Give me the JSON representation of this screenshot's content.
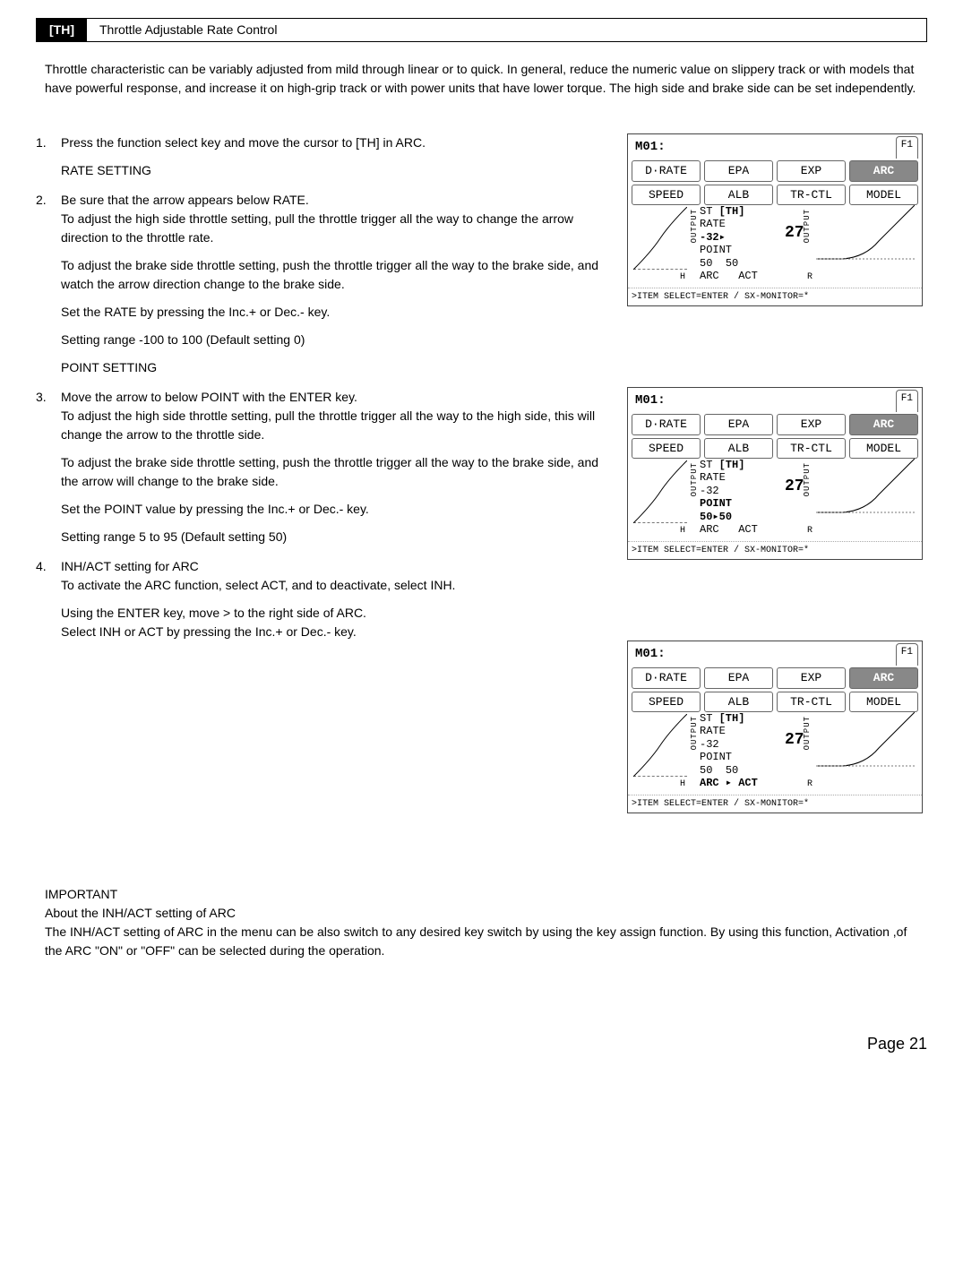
{
  "header": {
    "tag": "[TH]",
    "title": "Throttle Adjustable Rate Control"
  },
  "intro": "Throttle characteristic can be variably adjusted from mild through linear or to quick. In general, reduce the numeric value on slippery track or with models that have powerful response, and increase it on high-grip track or with power units that have lower torque. The high side and brake side can be set independently.",
  "step1": {
    "text": "Press the function select key and move the cursor to [TH] in ARC."
  },
  "rate_heading": "RATE SETTING",
  "step2": {
    "line1": "Be sure that the arrow appears below RATE.",
    "line2": "To adjust the high side throttle setting, pull the throttle trigger all the way to change the arrow direction to the throttle rate.",
    "line3": "To adjust the brake side throttle setting, push the throttle trigger all the way to the brake side, and watch the arrow direction change to the brake side.",
    "line4": "Set the RATE by pressing the Inc.+ or Dec.- key.",
    "line5": "Setting range -100 to 100 (Default setting  0)"
  },
  "point_heading": "POINT SETTING",
  "step3": {
    "line1": "Move the arrow to below POINT with the ENTER key.",
    "line2": "To adjust the high side throttle setting, pull the throttle trigger all the way to the high side, this will change the arrow to the throttle side.",
    "line3": "To adjust the brake side throttle setting, push the throttle trigger all the way to the brake side, and the arrow will change to the brake side.",
    "line4": "Set the POINT value by pressing the Inc.+ or Dec.- key.",
    "line5": "Setting range 5 to 95 (Default setting  50)"
  },
  "step4": {
    "heading": "INH/ACT setting for ARC",
    "line1": "To activate the ARC function, select ACT, and to deactivate, select INH.",
    "line2": "Using the ENTER key, move > to the right side of ARC.",
    "line3": "Select INH or ACT by pressing the Inc.+ or Dec.- key."
  },
  "lcd_common": {
    "model": "M01:",
    "fn_tab": "F1",
    "tabs_row1": [
      "D·RATE",
      "EPA",
      "EXP",
      "ARC"
    ],
    "tabs_row2": [
      "SPEED",
      "ALB",
      "TR-CTL",
      "MODEL"
    ],
    "active_tab": "ARC",
    "output_label": "OUTPUT",
    "ch_label": "[TH]",
    "st_label": "ST",
    "rate_label": "RATE",
    "point_label": "POINT",
    "arc_label": "ARC",
    "act_label": "ACT",
    "h_label": "H",
    "r_label": "R",
    "footer": ">ITEM SELECT=ENTER / SX-MONITOR=*"
  },
  "lcd1": {
    "rate_val": "-32▸",
    "point_val": "50",
    "right_val": "27",
    "mid_val": "50"
  },
  "lcd2": {
    "rate_val": "-32",
    "point_val": "50▸50",
    "right_val": "27"
  },
  "lcd3": {
    "rate_val": "-32",
    "point_val": "50",
    "right_val": "27",
    "mid_val": "50",
    "arc_arrow": "ARC ▸",
    "act_emph": "ACT"
  },
  "important": {
    "heading": "IMPORTANT",
    "subheading": "About the INH/ACT setting of ARC",
    "body": "The INH/ACT setting of ARC in the menu can be also switch to any desired key switch by using the key assign function. By using this function, Activation ,of the ARC \"ON\" or \"OFF\" can be selected during the operation."
  },
  "page_number": "Page 21"
}
